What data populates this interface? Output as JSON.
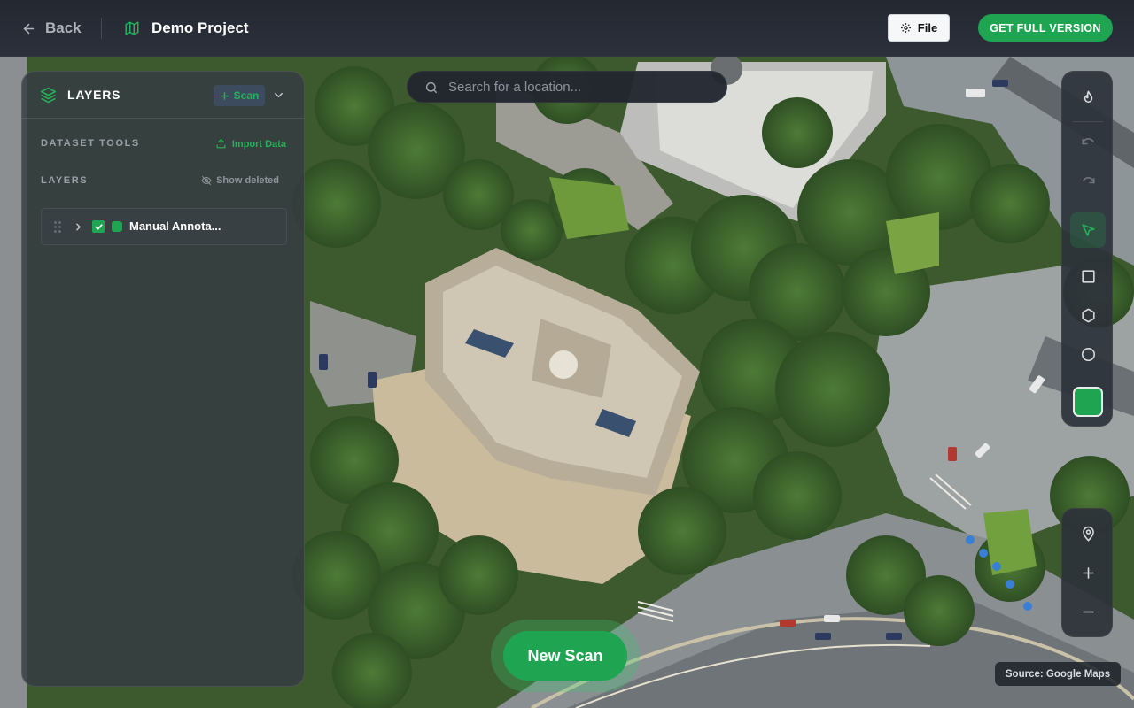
{
  "header": {
    "back_label": "Back",
    "project_name": "Demo Project",
    "file_label": "File",
    "full_version_label": "GET FULL VERSION"
  },
  "panel": {
    "title": "LAYERS",
    "scan_label": "Scan",
    "dataset_tools_label": "DATASET TOOLS",
    "import_label": "Import Data",
    "layers_label": "LAYERS",
    "show_deleted_label": "Show deleted",
    "layers": [
      {
        "name": "Manual Annota...",
        "visible": true,
        "color": "#1fa552"
      }
    ]
  },
  "search": {
    "placeholder": "Search for a location..."
  },
  "toolbar": {
    "tools": [
      "flame-icon",
      "undo-icon",
      "redo-icon",
      "select-pointer-icon",
      "rectangle-icon",
      "polygon-icon",
      "circle-icon",
      "color-swatch"
    ],
    "active_tool": "select-pointer-icon",
    "draw_color": "#1fa552"
  },
  "map_controls": {
    "tools": [
      "location-pin-icon",
      "zoom-in-icon",
      "zoom-out-icon"
    ]
  },
  "new_scan_label": "New Scan",
  "attribution": "Source: Google Maps",
  "colors": {
    "accent": "#1fa552",
    "topbar": "#262b34",
    "panel": "#343a42"
  }
}
